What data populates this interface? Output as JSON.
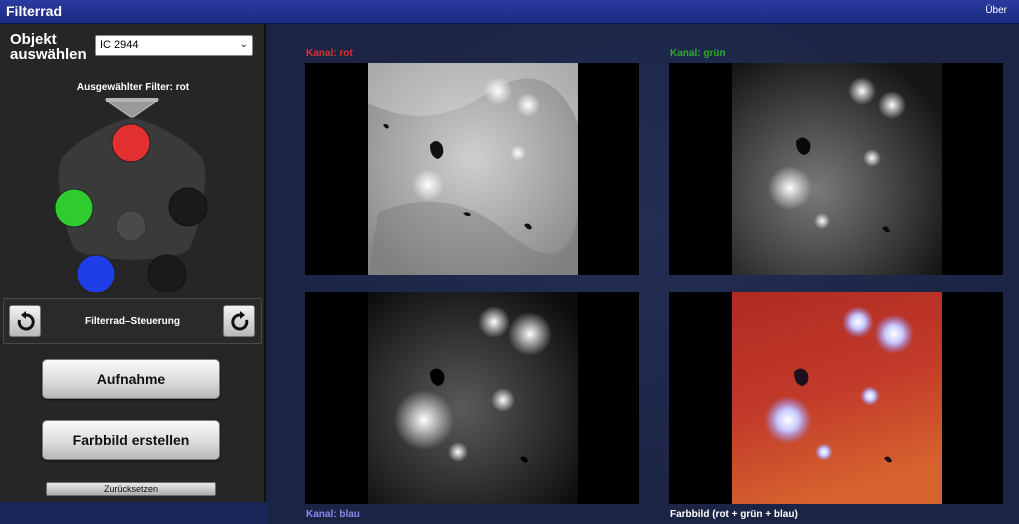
{
  "app": {
    "title": "Filterrad",
    "about": "Über"
  },
  "object": {
    "label": "Objekt auswählen",
    "selected": "IC 2944"
  },
  "filter": {
    "selected_label": "Ausgewählter Filter: rot",
    "slots": [
      {
        "name": "rot",
        "color": "#e23030"
      },
      {
        "name": "grün",
        "color": "#2ecc2e"
      },
      {
        "name": "blau",
        "color": "#1f3ee8"
      },
      {
        "name": "leer",
        "color": "#1a1a1a"
      },
      {
        "name": "leer",
        "color": "#1a1a1a"
      }
    ]
  },
  "control": {
    "label": "Filterrad–Steuerung"
  },
  "buttons": {
    "capture": "Aufnahme",
    "color_image": "Farbbild erstellen",
    "reset": "Zurücksetzen"
  },
  "panels": {
    "red": {
      "label": "Kanal: rot",
      "color": "#e03030"
    },
    "green": {
      "label": "Kanal: grün",
      "color": "#2fa82f"
    },
    "blue": {
      "label": "Kanal: blau",
      "color": "#8a8cf0"
    },
    "composite": {
      "label": "Farbbild (rot + grün + blau)",
      "color": "#ffffff"
    }
  }
}
